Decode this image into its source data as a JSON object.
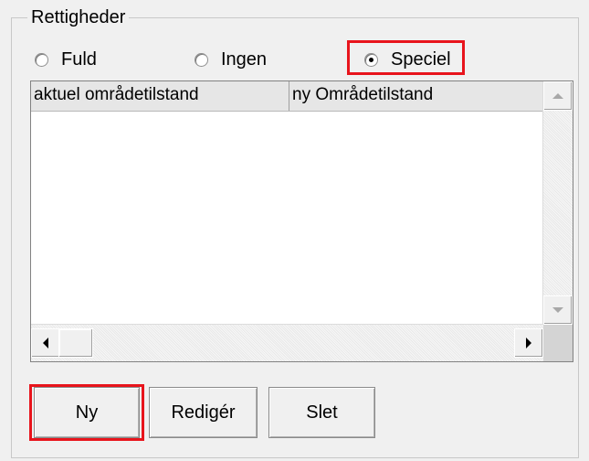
{
  "group": {
    "title": "Rettigheder"
  },
  "radios": [
    {
      "label": "Fuld",
      "checked": false
    },
    {
      "label": "Ingen",
      "checked": false
    },
    {
      "label": "Speciel",
      "checked": true
    }
  ],
  "list": {
    "columns": [
      "aktuel områdetilstand",
      "ny Områdetilstand"
    ]
  },
  "buttons": {
    "new_label": "Ny",
    "edit_label": "Redigér",
    "delete_label": "Slet"
  },
  "highlight_color": "#e8141c"
}
